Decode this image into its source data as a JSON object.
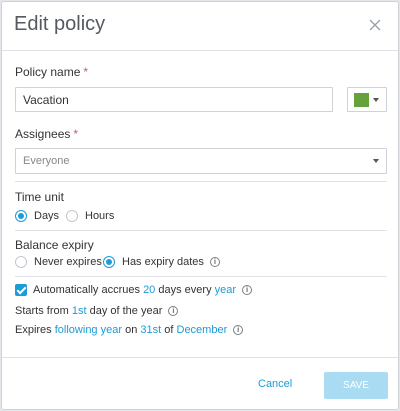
{
  "dialog": {
    "title": "Edit policy",
    "close_icon": "close-icon"
  },
  "policy_name": {
    "label": "Policy name",
    "required_mark": "*",
    "value": "Vacation",
    "color": "#64a23b"
  },
  "assignees": {
    "label": "Assignees",
    "required_mark": "*",
    "value": "Everyone"
  },
  "time_unit": {
    "label": "Time unit",
    "options": [
      "Days",
      "Hours"
    ],
    "selected": "Days"
  },
  "balance_expiry": {
    "label": "Balance expiry",
    "options": [
      "Never expires",
      "Has expiry dates"
    ],
    "selected": "Has expiry dates",
    "info_icon": "info-icon"
  },
  "accrual": {
    "checked": true,
    "prefix": "Automatically accrues",
    "amount": "20",
    "middle": "days every",
    "period": "year"
  },
  "starts_from": {
    "prefix": "Starts from",
    "day": "1st",
    "suffix": "day of the year"
  },
  "expires": {
    "prefix": "Expires",
    "when": "following year",
    "on": "on",
    "day": "31st",
    "of": "of",
    "month": "December"
  },
  "footer": {
    "cancel_label": "Cancel",
    "save_label": "SAVE"
  },
  "colors": {
    "accent": "#1b9bd7",
    "save_disabled": "#a9dcf3",
    "required": "#e05252"
  }
}
